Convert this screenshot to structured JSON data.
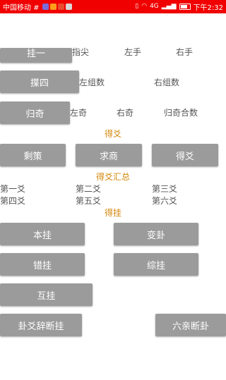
{
  "status_bar": {
    "carrier": "中国移动 #",
    "time": "下午2:32",
    "signal": "4G",
    "colors": {
      "bg": "#f00000",
      "icon1": "#7b6cd9",
      "icon2": "#ff9f1c",
      "icon3": "#e94d2f",
      "icon4": "#d9d9d9"
    }
  },
  "row1": {
    "button": "挂一",
    "labels": [
      "指尖",
      "左手",
      "右手"
    ]
  },
  "row2": {
    "button": "揲四",
    "labels": [
      "左组数",
      "右组数"
    ]
  },
  "row3": {
    "button": "归奇",
    "labels": [
      "左奇",
      "右奇",
      "归奇合数"
    ]
  },
  "de_yao": {
    "header": "得爻",
    "buttons": [
      "剩策",
      "求商",
      "得爻"
    ]
  },
  "summary": {
    "header": "得爻汇总",
    "cells": [
      "第一爻",
      "第二爻",
      "第三爻",
      "第四爻",
      "第五爻",
      "第六爻"
    ]
  },
  "de_gua": {
    "header": "得挂",
    "buttons": [
      "本挂",
      "变卦",
      "错挂",
      "综挂",
      "互挂",
      "卦爻辞断挂",
      "六亲断卦"
    ]
  },
  "theme": {
    "button": "#9b9b9b",
    "section_header": "#d4870a"
  }
}
